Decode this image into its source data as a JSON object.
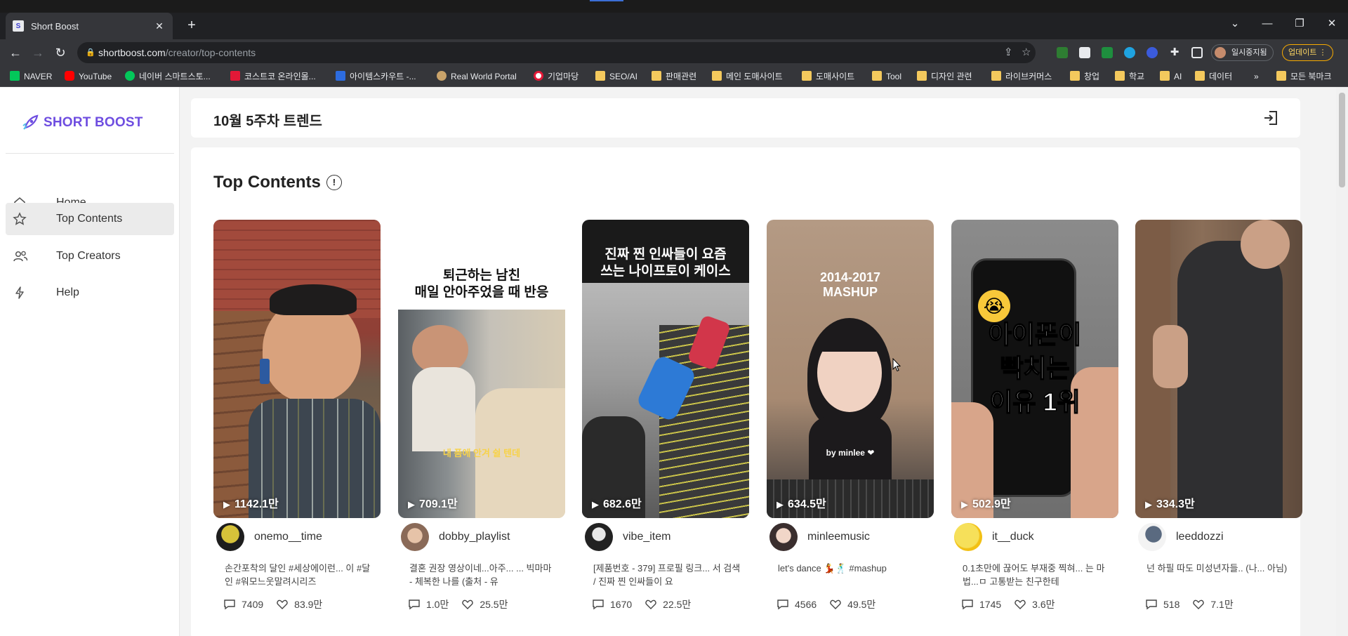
{
  "browser": {
    "tab_title": "Short Boost",
    "url_host": "shortboost.com",
    "url_path": "/creator/top-contents",
    "suspended_label": "일시중지됨",
    "update_label": "업데이트",
    "bookmarks": [
      "NAVER",
      "YouTube",
      "네이버 스마트스토...",
      "코스트코 온라인몰...",
      "아이템스카우트 -...",
      "Real World Portal",
      "기업마당",
      "SEO/AI",
      "판매관련",
      "메인 도매사이트",
      "도매사이트",
      "Tool",
      "디자인 관련",
      "라이브커머스",
      "창업",
      "학교",
      "AI",
      "데이터",
      "»",
      "모든 북마크"
    ]
  },
  "sidebar": {
    "logo_text": "SHORT BOOST",
    "items": [
      {
        "label": "Home",
        "icon": "home-icon"
      },
      {
        "label": "Top Contents",
        "icon": "star-icon"
      },
      {
        "label": "Top Creators",
        "icon": "users-icon"
      },
      {
        "label": "Help",
        "icon": "bolt-icon"
      }
    ]
  },
  "header": {
    "week_title": "10월 5주차 트렌드"
  },
  "main": {
    "section_title": "Top Contents"
  },
  "cards": [
    {
      "views": "1142.1만",
      "creator": "onemo__time",
      "desc": "손간포착의 달인 #세상에이런... 이 #달인 #워모느웃말려시리즈",
      "comments": "7409",
      "likes": "83.9만"
    },
    {
      "views": "709.1만",
      "creator": "dobby_playlist",
      "desc": "결혼 권장 영상이네...아주... ... 빅마마 - 체복한 나를 (출처 - 유",
      "comments": "1.0만",
      "likes": "25.5만",
      "overlay": [
        "퇴근하는 남친",
        "매일 안아주었을 때 반응"
      ],
      "caption": "내 품에 안겨 쉴 텐데"
    },
    {
      "views": "682.6만",
      "creator": "vibe_item",
      "desc": "[제품번호 - 379] 프로필 링크... 서 검색 / 진짜 찐 인싸들이 요",
      "comments": "1670",
      "likes": "22.5만",
      "overlay": [
        "진짜 찐 인싸들이 요즘",
        "쓰는 나이프토이 케이스"
      ]
    },
    {
      "views": "634.5만",
      "creator": "minleemusic",
      "desc": "let's dance 💃🕺 #mashup",
      "comments": "4566",
      "likes": "49.5만",
      "overlay": [
        "2014-2017",
        "MASHUP"
      ],
      "caption": "by minlee ❤"
    },
    {
      "views": "502.9만",
      "creator": "it__duck",
      "desc": "0.1초만에 끊어도 부재중 찍혀... 는 마법...ㅁ 고통받는 친구한테",
      "comments": "1745",
      "likes": "3.6만",
      "overlay": [
        "아이폰이",
        "빡치는",
        "이유 1위"
      ]
    },
    {
      "views": "334.3만",
      "creator": "leeddozzi",
      "desc": "넌 하필 따도 미성년자들.. (나... 아님)",
      "comments": "518",
      "likes": "7.1만"
    }
  ]
}
